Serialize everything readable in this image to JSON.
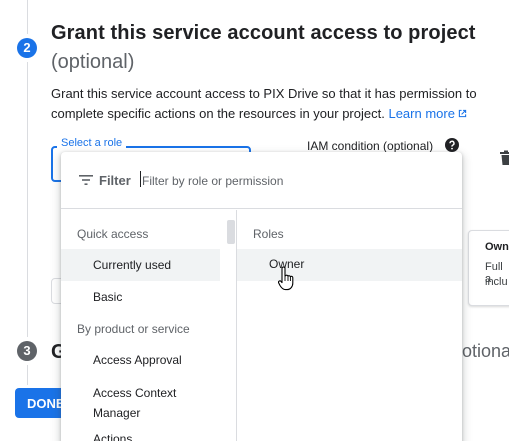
{
  "step2": {
    "number": "2",
    "title": "Grant this service account access to project",
    "optional": "(optional)",
    "description": "Grant this service account access to PIX Drive so that it has permission to complete specific actions on the resources in your project.",
    "learn_more": "Learn more"
  },
  "role_field": {
    "label": "Select a role"
  },
  "iam_condition": {
    "label": "IAM condition (optional)"
  },
  "step3": {
    "number": "3",
    "title_partial": "G",
    "optional_partial": "otiona"
  },
  "done_button": {
    "label": "DONE"
  },
  "role_card": {
    "title": "Own",
    "line1": "Full a",
    "line2": "inclu"
  },
  "dropdown": {
    "filter_word": "Filter",
    "filter_placeholder": "Filter by role or permission",
    "left_column": {
      "quick_access_header": "Quick access",
      "items_quick": [
        "Currently used",
        "Basic"
      ],
      "by_product_header": "By product or service",
      "items_product": [
        "Access Approval",
        "Access Context Manager",
        "Actions"
      ]
    },
    "right_column": {
      "header": "Roles",
      "items": [
        "Owner"
      ]
    }
  },
  "colors": {
    "accent": "#1a73e8",
    "text": "#202124",
    "muted": "#5f6368",
    "selected_bg": "#f1f3f4"
  },
  "icons": [
    "filter-icon",
    "help-icon",
    "trash-icon",
    "external-link-icon",
    "hand-cursor-icon"
  ]
}
